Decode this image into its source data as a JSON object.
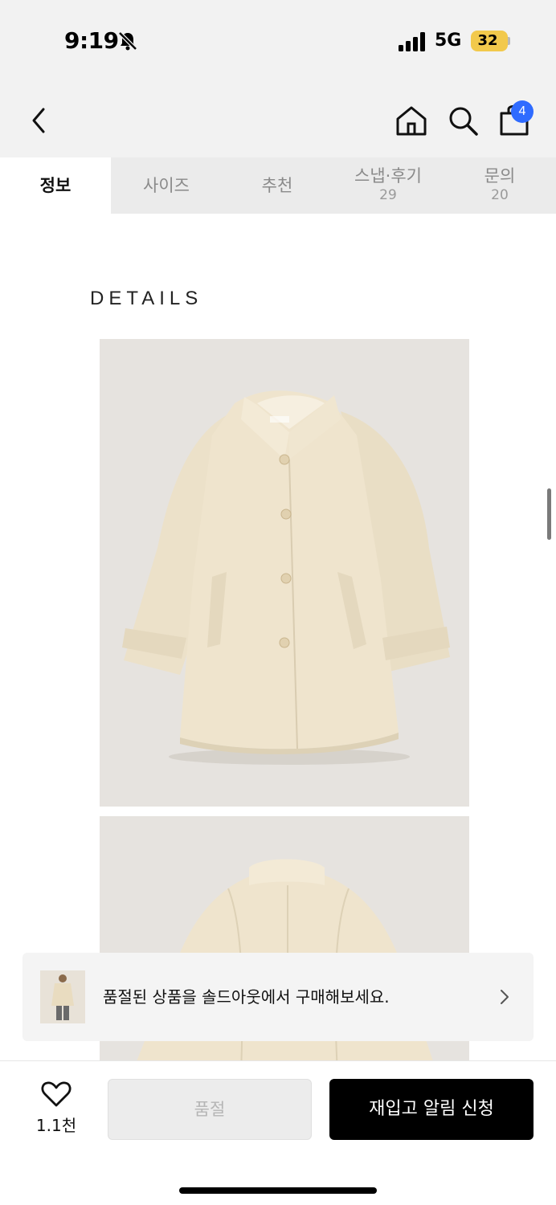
{
  "status_bar": {
    "time": "9:19",
    "network": "5G",
    "battery": "32",
    "icons": [
      "bell-slash-icon",
      "signal-icon",
      "battery-icon"
    ],
    "battery_color": "#f2c94c"
  },
  "header": {
    "icons": [
      "back-icon",
      "home-icon",
      "search-icon",
      "cart-icon"
    ],
    "cart_badge": "4",
    "badge_color": "#2f6bff"
  },
  "tabs": [
    {
      "label": "정보",
      "active": true
    },
    {
      "label": "사이즈"
    },
    {
      "label": "추천"
    },
    {
      "label": "스냅·후기",
      "count": "29"
    },
    {
      "label": "문의",
      "count": "20"
    }
  ],
  "content": {
    "heading": "DETAILS"
  },
  "banner": {
    "text": "품절된 상품을 솔드아웃에서 구매해보세요.",
    "icons": [
      "product-thumbnail",
      "chevron-right-icon"
    ]
  },
  "bottom_bar": {
    "like_count": "1.1천",
    "soldout_label": "품절",
    "restock_label": "재입고 알림 신청",
    "icons": [
      "heart-icon"
    ]
  }
}
